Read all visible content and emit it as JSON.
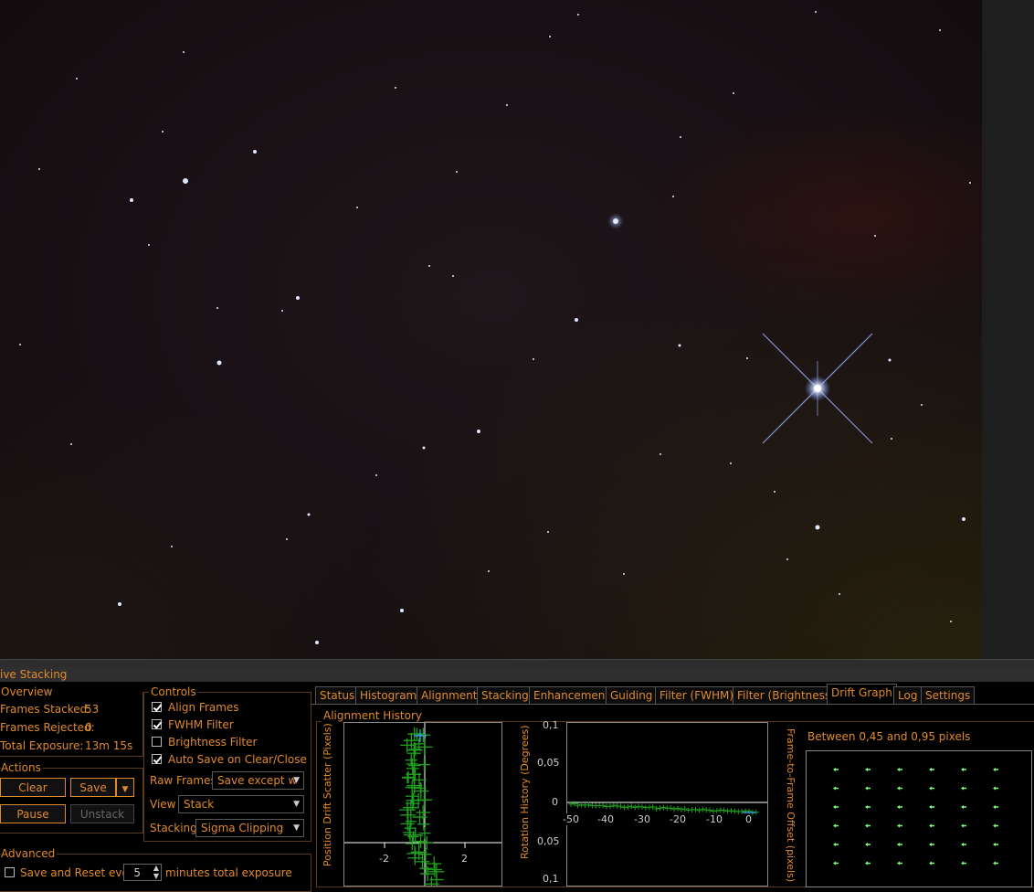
{
  "panel_title": "ive Stacking",
  "overview": {
    "title": "Overview",
    "frames_stacked_label": "Frames Stacked:",
    "frames_stacked_value": "53",
    "frames_rejected_label": "Frames Rejected:",
    "frames_rejected_value": "0",
    "total_exposure_label": "Total Exposure:",
    "total_exposure_value": "13m 15s"
  },
  "actions": {
    "title": "Actions",
    "clear": "Clear",
    "save": "Save",
    "pause": "Pause",
    "unstack": "Unstack"
  },
  "controls": {
    "title": "Controls",
    "align_frames": "Align Frames",
    "fwhm_filter": "FWHM Filter",
    "brightness_filter": "Brightness Filter",
    "auto_save": "Auto Save on Clear/Close",
    "raw_frames_label": "Raw Frames",
    "raw_frames_value": "Save except w",
    "view_label": "View",
    "view_value": "Stack",
    "stacking_label": "Stacking",
    "stacking_value": "Sigma Clipping"
  },
  "advanced": {
    "title": "Advanced",
    "save_reset_label": "Save and Reset every",
    "save_reset_value": "5",
    "minutes_label": "minutes total exposure"
  },
  "tabs": [
    "Status",
    "Histogram",
    "Alignment",
    "Stacking",
    "Enhancement",
    "Guiding",
    "Filter (FWHM)",
    "Filter (Brightness)",
    "Drift Graph",
    "Log",
    "Settings"
  ],
  "active_tab": "Drift Graph",
  "drift": {
    "group_title": "Alignment History",
    "scatter_ylabel": "Position Drift Scatter (Pixels)",
    "scatter_ticks": [
      "-2",
      "2"
    ],
    "rotation_ylabel": "Rotation History (Degrees)",
    "rotation_yticks": [
      "0,1",
      "0,05",
      "0",
      "0,05",
      "0,1"
    ],
    "rotation_xticks": [
      "-50",
      "-40",
      "-30",
      "-20",
      "-10",
      "0"
    ],
    "offset_caption": "Between 0,45 and 0,95 pixels",
    "offset_ylabel": "Frame-to-Frame Offset (pixels)"
  },
  "colors": {
    "accent": "#e08a2c",
    "marker": "#1fa01f",
    "arrow": "#7fff7f"
  }
}
